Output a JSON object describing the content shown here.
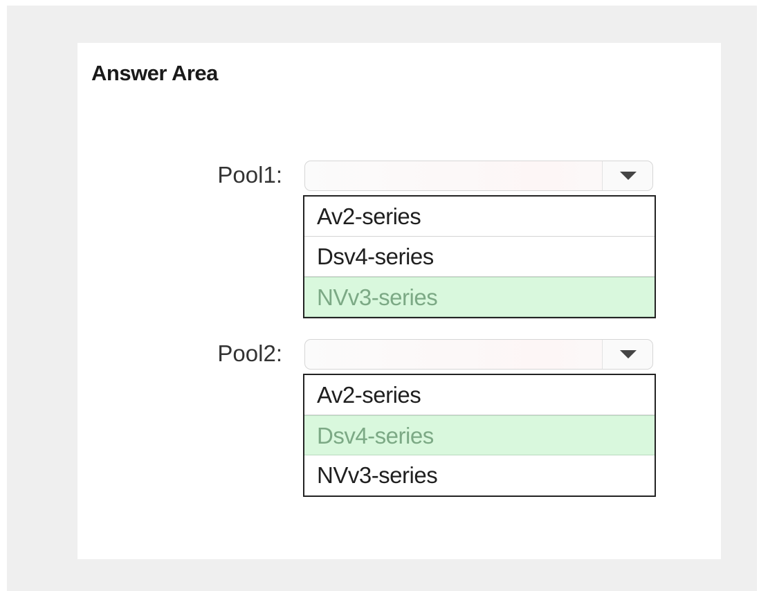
{
  "answer_area": {
    "title": "Answer Area"
  },
  "pools": [
    {
      "label": "Pool1:",
      "options": [
        {
          "label": "Av2-series",
          "selected": false
        },
        {
          "label": "Dsv4-series",
          "selected": false
        },
        {
          "label": "NVv3-series",
          "selected": true
        }
      ]
    },
    {
      "label": "Pool2:",
      "options": [
        {
          "label": "Av2-series",
          "selected": false
        },
        {
          "label": "Dsv4-series",
          "selected": true
        },
        {
          "label": "NVv3-series",
          "selected": false
        }
      ]
    }
  ],
  "colors": {
    "selected_background": "#d9f8dd",
    "selected_text": "#7ca985",
    "outer_frame": "#efefef"
  },
  "icons": {
    "dropdown": "chevron-down-icon"
  }
}
